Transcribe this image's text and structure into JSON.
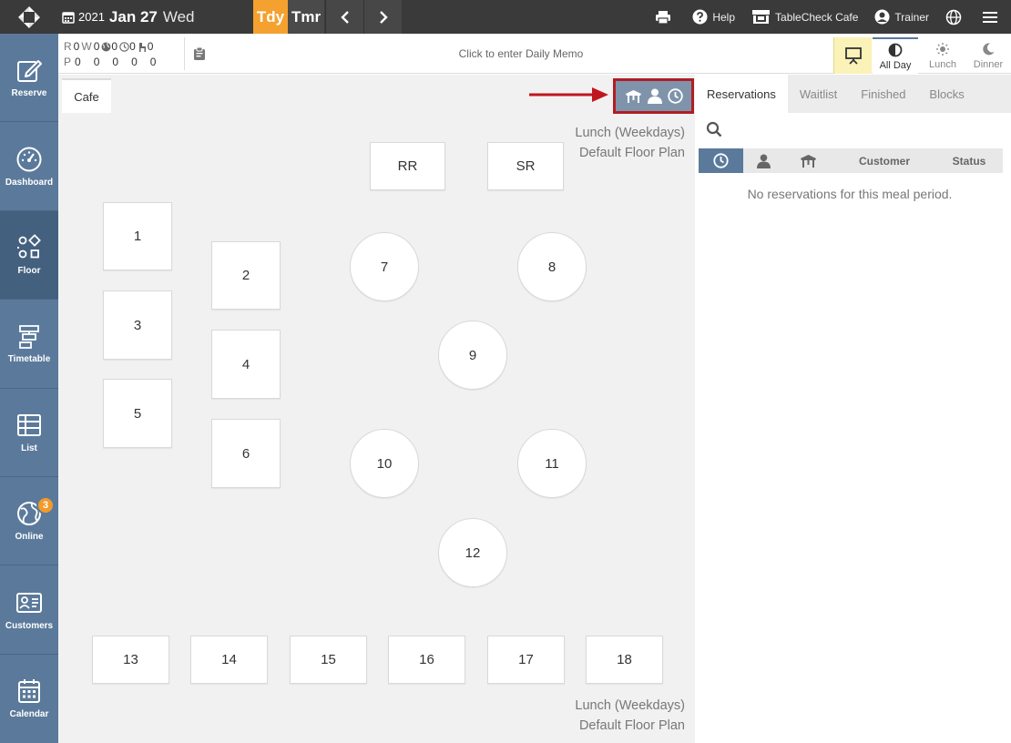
{
  "topbar": {
    "date_year": "2021",
    "date_monthday": "Jan 27",
    "date_weekday": "Wed",
    "today_label": "Tdy",
    "tomorrow_label": "Tmr",
    "help_label": "Help",
    "restaurant_label": "TableCheck Cafe",
    "user_label": "Trainer",
    "accent_color": "#f4a12f"
  },
  "sidebar": {
    "items": [
      {
        "label": "Reserve",
        "icon": "edit-icon"
      },
      {
        "label": "Dashboard",
        "icon": "gauge-icon"
      },
      {
        "label": "Floor",
        "icon": "shapes-icon"
      },
      {
        "label": "Timetable",
        "icon": "timetable-icon"
      },
      {
        "label": "List",
        "icon": "list-icon"
      },
      {
        "label": "Online",
        "icon": "globe-icon",
        "badge": "3"
      },
      {
        "label": "Customers",
        "icon": "id-card-icon"
      },
      {
        "label": "Calendar",
        "icon": "calendar-icon"
      }
    ],
    "active": "Floor",
    "color": "#5b7a9b"
  },
  "counts": {
    "r_label": "R",
    "p_label": "P",
    "w_label": "W",
    "r_values": [
      "0",
      "0",
      "0",
      "0",
      "0"
    ],
    "p_values": [
      "0",
      "0",
      "0",
      "0",
      "0"
    ]
  },
  "memo": {
    "placeholder": "Click to enter Daily Memo"
  },
  "periods": [
    {
      "label": "All Day",
      "icon": "half-circle-icon",
      "active": true
    },
    {
      "label": "Lunch",
      "icon": "sun-icon",
      "active": false
    },
    {
      "label": "Dinner",
      "icon": "moon-icon",
      "active": false
    }
  ],
  "floor": {
    "tab_label": "Cafe",
    "plan_line1": "Lunch (Weekdays)",
    "plan_line2": "Default Floor Plan",
    "tables": [
      "RR",
      "SR",
      "1",
      "2",
      "3",
      "4",
      "5",
      "6",
      "7",
      "8",
      "9",
      "10",
      "11",
      "12",
      "13",
      "14",
      "15",
      "16",
      "17",
      "18"
    ]
  },
  "panel": {
    "tabs": [
      "Reservations",
      "Waitlist",
      "Finished",
      "Blocks"
    ],
    "active_tab": "Reservations",
    "search_placeholder": "",
    "columns": {
      "customer": "Customer",
      "status": "Status"
    },
    "empty_message": "No reservations for this meal period."
  }
}
